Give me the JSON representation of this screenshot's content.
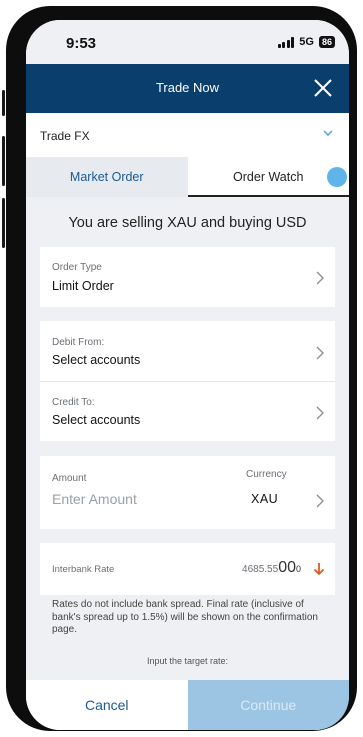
{
  "status_bar": {
    "time": "9:53",
    "network": "5G",
    "battery": "86"
  },
  "app_bar": {
    "title": "Trade Now",
    "close_icon": "close-icon"
  },
  "trade_type": {
    "label": "Trade FX",
    "icon": "chevron-down-icon"
  },
  "tabs": [
    {
      "label": "Market Order",
      "selected": false
    },
    {
      "label": "Order Watch",
      "selected": true
    }
  ],
  "headline": "You are selling XAU and buying USD",
  "order_type": {
    "label": "Order Type",
    "value": "Limit Order"
  },
  "debit_from": {
    "label": "Debit From:",
    "value": "Select accounts"
  },
  "credit_to": {
    "label": "Credit To:",
    "value": "Select accounts"
  },
  "amount": {
    "label": "Amount",
    "placeholder": "Enter Amount"
  },
  "currency": {
    "label": "Currency",
    "value": "XAU"
  },
  "interbank_rate": {
    "label": "Interbank Rate",
    "value_prefix": "4685.55",
    "value_big": "00",
    "value_sup": "0",
    "trend": "down",
    "trend_color": "#e05a1e"
  },
  "note": "Rates do not include bank spread. Final rate (inclusive of bank's spread up to 1.5%) will be shown on the confirmation page.",
  "target_prompt": "Input the target rate:",
  "footer": {
    "cancel_label": "Cancel",
    "continue_label": "Continue"
  },
  "colors": {
    "brand_navy": "#0a3e6c",
    "accent_blue": "#1a5a96",
    "continue_disabled": "#9cc5e4"
  }
}
